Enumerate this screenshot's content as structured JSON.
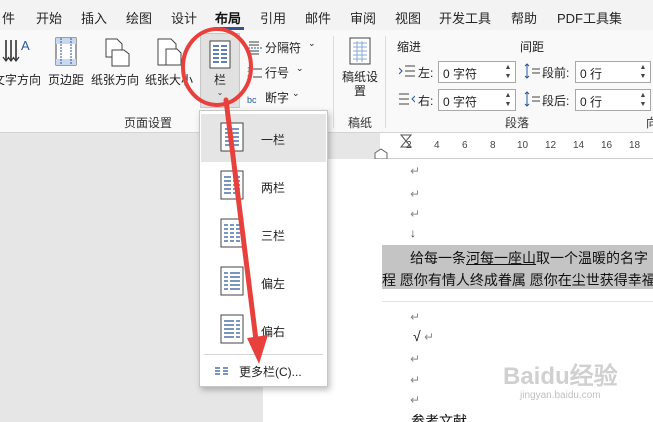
{
  "menu": {
    "tabs": [
      "件",
      "开始",
      "插入",
      "绘图",
      "设计",
      "布局",
      "引用",
      "邮件",
      "审阅",
      "视图",
      "开发工具",
      "帮助",
      "PDF工具集"
    ],
    "active_index": 5
  },
  "ribbon": {
    "text_direction": "文字方向",
    "margins": "页边距",
    "orientation": "纸张方向",
    "size": "纸张大小",
    "columns": "栏",
    "breaks": "分隔符",
    "line_numbers": "行号",
    "hyphenation": "断字",
    "group_page_setup": "页面设置",
    "draft_paper": "稿纸设置",
    "group_draft_paper": "稿纸",
    "indent_title": "缩进",
    "spacing_title": "间距",
    "indent_left_label": "左:",
    "indent_left_value": "0 字符",
    "indent_right_label": "右:",
    "indent_right_value": "0 字符",
    "space_before_label": "段前:",
    "space_before_value": "0 行",
    "space_after_label": "段后:",
    "space_after_value": "0 行",
    "group_paragraph": "段落",
    "group_arrange_partial": "向"
  },
  "ruler": {
    "ticks": [
      "2",
      "4",
      "6",
      "8",
      "10",
      "12",
      "14",
      "16",
      "18"
    ]
  },
  "document": {
    "line1_pre": "给每一条",
    "line1_u1": "河每一座山",
    "line1_mid": "取一个温暖的名字",
    "line2": "程 愿你有情人终成眷属 愿你在尘世获得幸福",
    "check": "√",
    "last": "参考文献"
  },
  "dropdown": {
    "items": [
      "一栏",
      "两栏",
      "三栏",
      "偏左",
      "偏右"
    ],
    "more": "更多栏(C)..."
  },
  "colors": {
    "accent": "#2b579a",
    "annotation": "#e8413d",
    "selection": "#c4c4c4"
  },
  "watermark": {
    "brand": "Baidu经验",
    "url": "jingyan.baidu.com"
  }
}
